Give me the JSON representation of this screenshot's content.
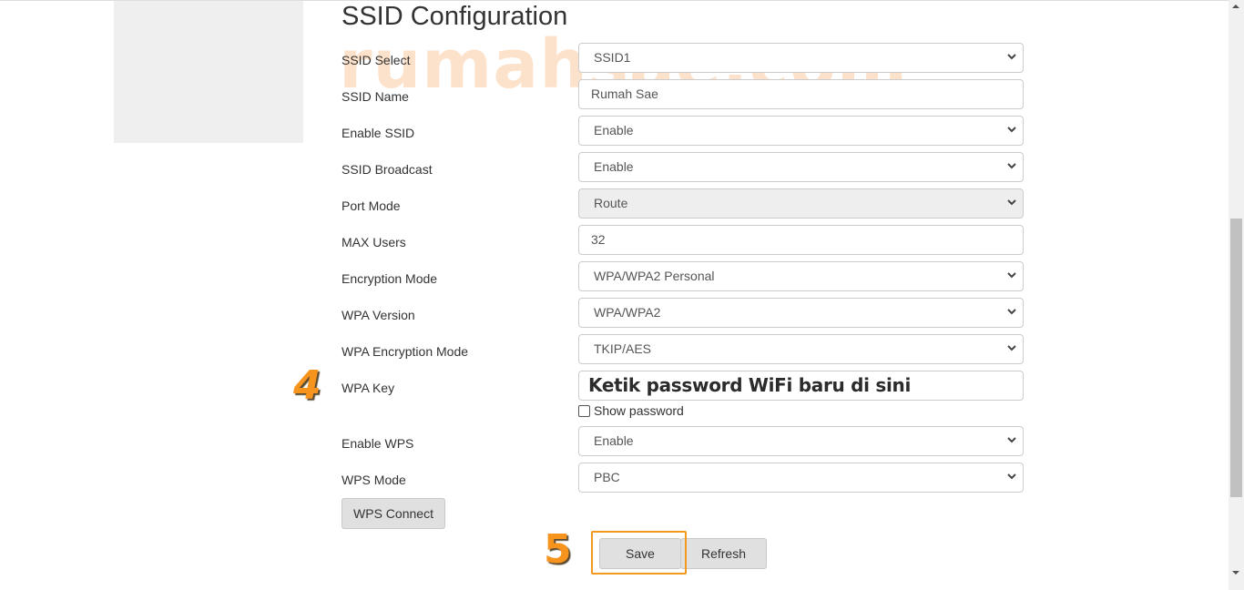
{
  "page": {
    "title": "SSID Configuration",
    "watermark": "rumahsae.com"
  },
  "form": {
    "fields": [
      {
        "label": "SSID Select",
        "value": "SSID1",
        "type": "select"
      },
      {
        "label": "SSID Name",
        "value": "Rumah Sae",
        "type": "text"
      },
      {
        "label": "Enable SSID",
        "value": "Enable",
        "type": "select"
      },
      {
        "label": "SSID Broadcast",
        "value": "Enable",
        "type": "select"
      },
      {
        "label": "Port Mode",
        "value": "Route",
        "type": "select",
        "disabled": true
      },
      {
        "label": "MAX Users",
        "value": "32",
        "type": "text"
      },
      {
        "label": "Encryption Mode",
        "value": "WPA/WPA2 Personal",
        "type": "select"
      },
      {
        "label": "WPA Version",
        "value": "WPA/WPA2",
        "type": "select"
      },
      {
        "label": "WPA Encryption Mode",
        "value": "TKIP/AES",
        "type": "select"
      },
      {
        "label": "WPA Key",
        "value": "Ketik password  WiFi baru di sini",
        "type": "password"
      },
      {
        "label": "Enable WPS",
        "value": "Enable",
        "type": "select"
      },
      {
        "label": "WPS Mode",
        "value": "PBC",
        "type": "select"
      }
    ],
    "show_password_label": "Show password",
    "show_password_checked": false,
    "wps_connect_label": "WPS Connect",
    "save_label": "Save",
    "refresh_label": "Refresh"
  },
  "annotations": {
    "step4": "4",
    "step5": "5",
    "accent_color": "#f7941d"
  }
}
